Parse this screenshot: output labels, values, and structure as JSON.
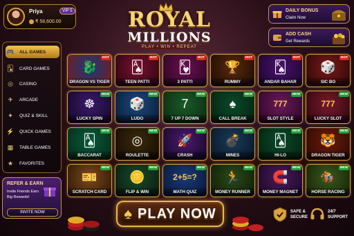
{
  "profile": {
    "name": "Priya",
    "vip": "VIP 5",
    "balance": "₹ 58,600.00"
  },
  "logo": {
    "main": "ROYAL",
    "sub": "MILLIONS",
    "tagline": "PLAY • WIN • REPEAT"
  },
  "promos": [
    {
      "title": "DAILY BONUS",
      "sub": "Claim Now"
    },
    {
      "title": "ADD CASH",
      "sub": "Get Rewards"
    }
  ],
  "sidebar": {
    "items": [
      {
        "label": "ALL GAMES",
        "icon": "gamepad-icon",
        "glyph": "🎮",
        "active": true
      },
      {
        "label": "CARD GAMES",
        "icon": "cards-icon",
        "glyph": "🂡",
        "active": false
      },
      {
        "label": "CASINO",
        "icon": "roulette-icon",
        "glyph": "◎",
        "active": false
      },
      {
        "label": "ARCADE",
        "icon": "rocket-icon",
        "glyph": "✈",
        "active": false
      },
      {
        "label": "QUIZ & SKILL",
        "icon": "brain-icon",
        "glyph": "✦",
        "active": false
      },
      {
        "label": "QUICK GAMES",
        "icon": "lightning-icon",
        "glyph": "⚡",
        "active": false
      },
      {
        "label": "TABLE GAMES",
        "icon": "table-icon",
        "glyph": "▦",
        "active": false
      },
      {
        "label": "FAVORITES",
        "icon": "star-icon",
        "glyph": "★",
        "active": false
      }
    ]
  },
  "refer": {
    "title": "REFER & EARN",
    "text": "Invite Friends Earn Big Rewards!",
    "button": "INVITE NOW"
  },
  "games": [
    {
      "label": "DRAGON VS TIGER",
      "badge": "HOT",
      "glyph": "🐉",
      "c1": "#1a3a7a",
      "c2": "#7a1a1a"
    },
    {
      "label": "TEEN PATTI",
      "badge": "HOT",
      "glyph": "🂡",
      "c1": "#7a1030",
      "c2": "#2a0610"
    },
    {
      "label": "3 PATTI",
      "badge": "HOT",
      "glyph": "🂾",
      "c1": "#6a1050",
      "c2": "#2a0620"
    },
    {
      "label": "RUMMY",
      "badge": "HOT",
      "glyph": "🏆",
      "c1": "#5a2a0a",
      "c2": "#1a0a04"
    },
    {
      "label": "ANDAR BAHAR",
      "badge": "HOT",
      "glyph": "🂮",
      "c1": "#4a1070",
      "c2": "#1a0628"
    },
    {
      "label": "SIC BO",
      "badge": "HOT",
      "glyph": "🎲",
      "c1": "#7a1a1a",
      "c2": "#2a0606"
    },
    {
      "label": "LUCKY SPIN",
      "badge": "NEW",
      "glyph": "☸",
      "c1": "#3a1a6a",
      "c2": "#140828"
    },
    {
      "label": "LUDO",
      "badge": "NEW",
      "glyph": "🎲",
      "c1": "#1a4a7a",
      "c2": "#0a1a3a"
    },
    {
      "label": "7 UP 7 DOWN",
      "badge": "NEW",
      "glyph": "7",
      "c1": "#1a5a2a",
      "c2": "#0a2a10"
    },
    {
      "label": "CALL BREAK",
      "badge": "NEW",
      "glyph": "♠",
      "c1": "#0a4a2a",
      "c2": "#04200f"
    },
    {
      "label": "SLOT STYLE",
      "badge": "NEW",
      "glyph": "777",
      "c1": "#6a1a5a",
      "c2": "#2a0624"
    },
    {
      "label": "LUCKY SLOT",
      "badge": "NEW",
      "glyph": "777",
      "c1": "#7a1a2a",
      "c2": "#2a0610"
    },
    {
      "label": "BACCARAT",
      "badge": "NEW",
      "glyph": "🂡",
      "c1": "#0a5a3a",
      "c2": "#042a1a"
    },
    {
      "label": "ROULETTE",
      "badge": "NEW",
      "glyph": "◎",
      "c1": "#3a2a0a",
      "c2": "#140a02"
    },
    {
      "label": "CRASH",
      "badge": "NEW",
      "glyph": "🚀",
      "c1": "#4a1a6a",
      "c2": "#14082a"
    },
    {
      "label": "MINES",
      "badge": "NEW",
      "glyph": "💣",
      "c1": "#1a3a5a",
      "c2": "#081624"
    },
    {
      "label": "HI-LO",
      "badge": "NEW",
      "glyph": "🂡",
      "c1": "#0a4a2a",
      "c2": "#04200f"
    },
    {
      "label": "DRAGON TIGER",
      "badge": "NEW",
      "glyph": "🐯",
      "c1": "#6a1a0a",
      "c2": "#2a0a04"
    },
    {
      "label": "SCRATCH CARD",
      "badge": "NEW",
      "glyph": "🎫",
      "c1": "#7a4a1a",
      "c2": "#2a1606"
    },
    {
      "label": "FLIP & WIN",
      "badge": "NEW",
      "glyph": "🪙",
      "c1": "#1a4a2a",
      "c2": "#081a0f"
    },
    {
      "label": "MATH QUIZ",
      "badge": "NEW",
      "glyph": "2+5=?",
      "c1": "#1a3a7a",
      "c2": "#081634"
    },
    {
      "label": "MONEY RUNNER",
      "badge": "NEW",
      "glyph": "🏃",
      "c1": "#2a4a1a",
      "c2": "#0f1a08"
    },
    {
      "label": "MONEY MAGNET",
      "badge": "NEW",
      "glyph": "🧲",
      "c1": "#4a1a5a",
      "c2": "#180824"
    },
    {
      "label": "HORSE RACING",
      "badge": "NEW",
      "glyph": "🏇",
      "c1": "#3a5a1a",
      "c2": "#142008"
    }
  ],
  "play_button": "PLAY NOW",
  "safe": {
    "line1": "SAFE &",
    "line2": "SECURE"
  },
  "support": {
    "line1": "24/7",
    "line2": "SUPPORT"
  }
}
